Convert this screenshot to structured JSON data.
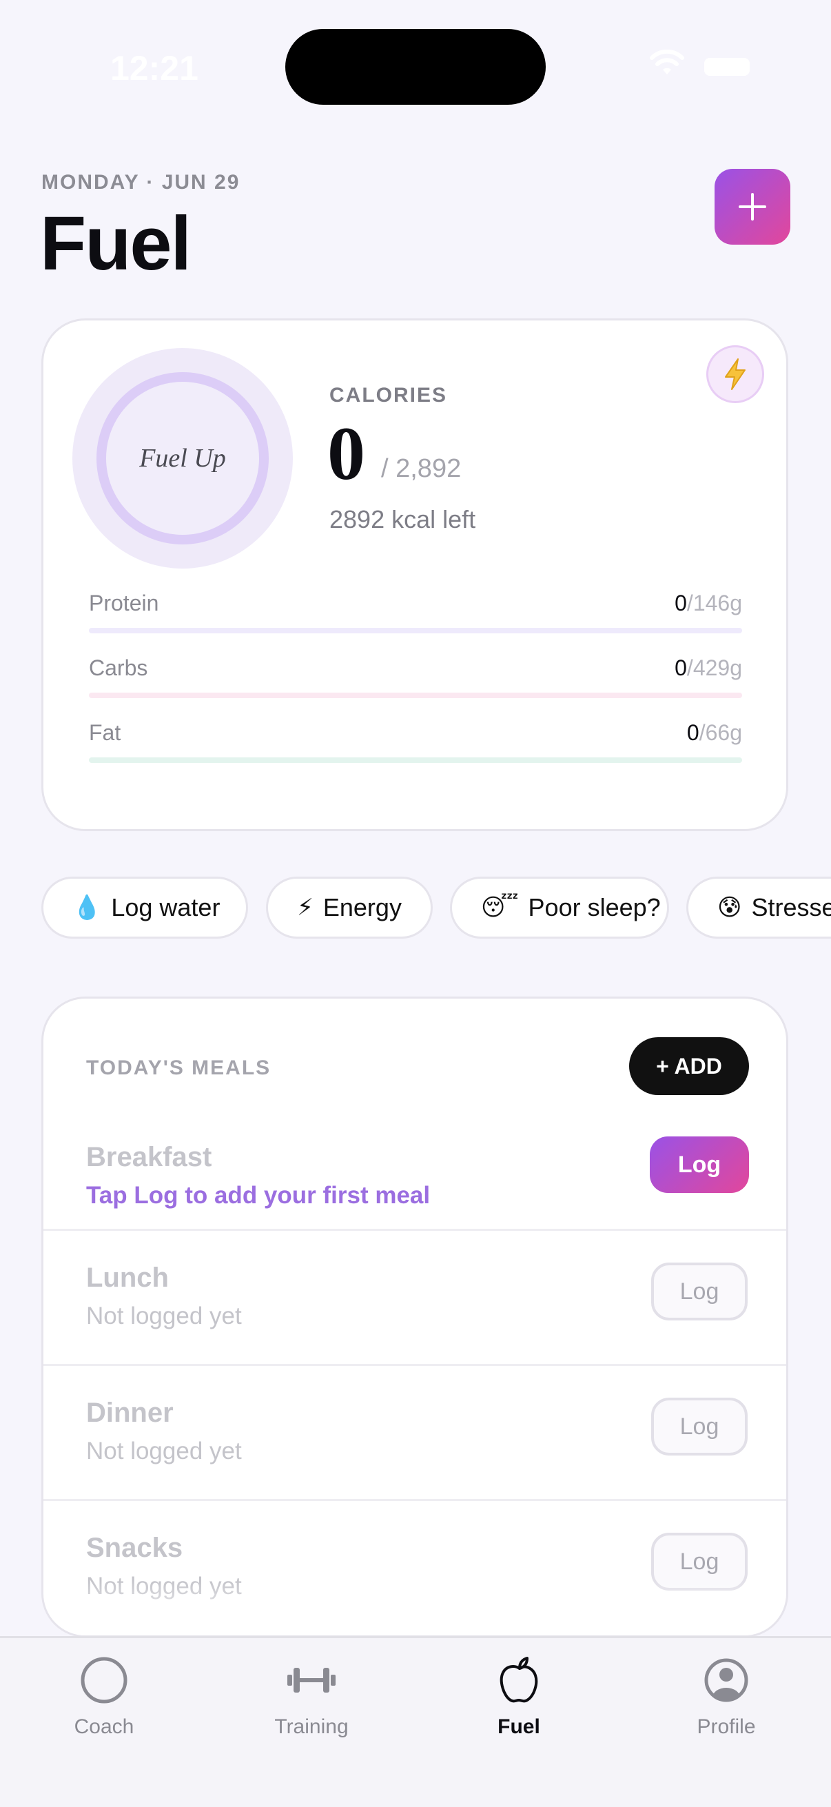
{
  "status_bar": {
    "time": "12:21"
  },
  "header": {
    "date": "MONDAY · JUN 29",
    "title": "Fuel"
  },
  "calories": {
    "ring_label": "Fuel Up",
    "label": "CALORIES",
    "value": "0",
    "goal": "/ 2,892",
    "left": "2892 kcal left",
    "badge_icon": "lightning-icon"
  },
  "macros": [
    {
      "name": "Protein",
      "current": "0",
      "goal": "/146g",
      "progress": 0,
      "color": "#eeeafc"
    },
    {
      "name": "Carbs",
      "current": "0",
      "goal": "/429g",
      "progress": 0,
      "color": "#fbe8f1"
    },
    {
      "name": "Fat",
      "current": "0",
      "goal": "/66g",
      "progress": 0,
      "color": "#e3f4ee"
    }
  ],
  "chips": [
    {
      "emoji": "💧",
      "label": "Log water"
    },
    {
      "emoji": "⚡",
      "label": "Energy"
    },
    {
      "emoji": "😴",
      "label": "Poor sleep?"
    },
    {
      "emoji": "😰",
      "label": "Stressed"
    }
  ],
  "meals": {
    "title": "TODAY'S MEALS",
    "add_label": "+ ADD",
    "items": [
      {
        "name": "Breakfast",
        "subtitle": "Tap Log to add your first meal",
        "button": "Log"
      },
      {
        "name": "Lunch",
        "subtitle": "Not logged yet",
        "button": "Log"
      },
      {
        "name": "Dinner",
        "subtitle": "Not logged yet",
        "button": "Log"
      },
      {
        "name": "Snacks",
        "subtitle": "Not logged yet",
        "button": "Log"
      }
    ]
  },
  "tabs": [
    {
      "label": "Coach",
      "icon": "circle-icon",
      "active": false
    },
    {
      "label": "Training",
      "icon": "dumbbell-icon",
      "active": false
    },
    {
      "label": "Fuel",
      "icon": "apple-icon",
      "active": true
    },
    {
      "label": "Profile",
      "icon": "person-icon",
      "active": false
    }
  ],
  "colors": {
    "accent_start": "#9a52e6",
    "accent_end": "#e2479b",
    "hint": "#9b6ee0"
  }
}
